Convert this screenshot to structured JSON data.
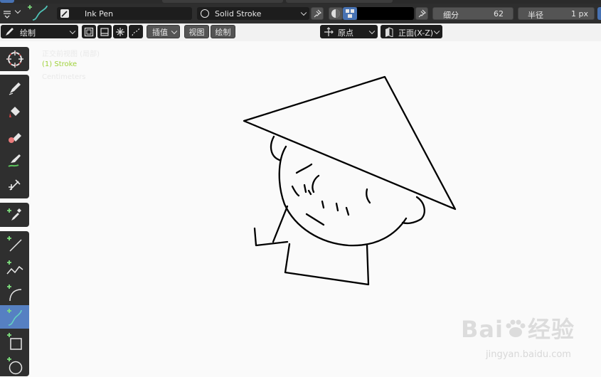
{
  "header": {
    "brush_name": "Ink Pen",
    "material_name": "Solid Stroke",
    "subdivide_label": "细分",
    "subdivide_value": "62",
    "radius_label": "半径",
    "radius_value": "1 px"
  },
  "tool_settings": {
    "mode_label": "绘制",
    "interpolate_label": "插值",
    "view_label": "视图",
    "draw_label": "绘制",
    "origin_label": "原点",
    "orientation_label": "正面(X-Z)"
  },
  "viewport": {
    "view_name": "正交前视图 (局部)",
    "object_name": "(1) Stroke",
    "units": "Centimeters"
  },
  "watermark": {
    "brand": "Bai",
    "brand_cn": "经验",
    "url": "jingyan.baidu.com"
  },
  "colors": {
    "accent": "#5680c2",
    "stroke": "#000000",
    "viewport_bg": "#fafafa",
    "toolbar_bg": "#2e2e2e",
    "object_name": "#9fd23a"
  },
  "sidebar_tools": [
    "cursor-icon",
    "draw-icon",
    "fill-icon",
    "erase-icon",
    "tint-icon",
    "cutter-icon",
    "eyedropper-icon",
    "line-icon",
    "polyline-icon",
    "arc-icon",
    "curve-icon",
    "box-icon",
    "circle-icon"
  ]
}
